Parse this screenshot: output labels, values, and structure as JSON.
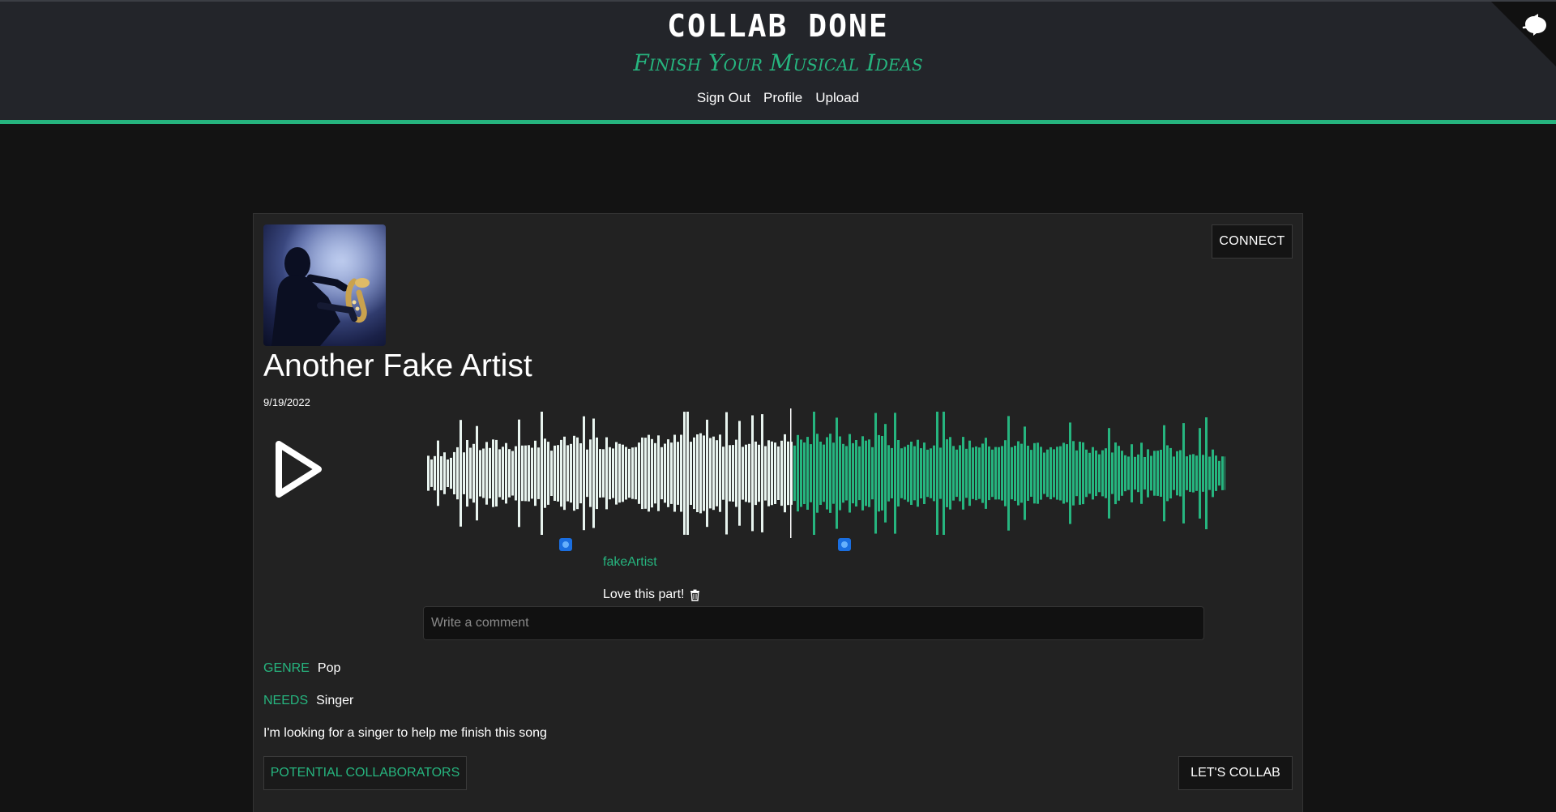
{
  "header": {
    "title": "COLLAB DONE",
    "tagline": "Finish Your Musical Ideas",
    "nav": [
      "Sign Out",
      "Profile",
      "Upload"
    ]
  },
  "post": {
    "connect_label": "CONNECT",
    "artist_name": "Another Fake Artist",
    "date": "9/19/2022",
    "play_icon": "play-icon",
    "cover_icon": "saxophone-player-image",
    "playback_progress": 0.456,
    "comment": {
      "user": "fakeArtist",
      "text": "Love this part!",
      "marker_icons": [
        "comment-avatar-icon",
        "comment-avatar-icon"
      ]
    },
    "comment_placeholder": "Write a comment",
    "genre_label": "GENRE",
    "genre_value": "Pop",
    "needs_label": "NEEDS",
    "needs_value": "Singer",
    "description": "I'm looking for a singer to help me finish this song",
    "potential_collaborators_label": "POTENTIAL COLLABORATORS",
    "lets_collab_label": "LET'S COLLAB"
  },
  "colors": {
    "accent": "#26b57f",
    "played": "#e8f4ef",
    "background": "#131313",
    "card": "#222222",
    "header": "#23252a"
  }
}
